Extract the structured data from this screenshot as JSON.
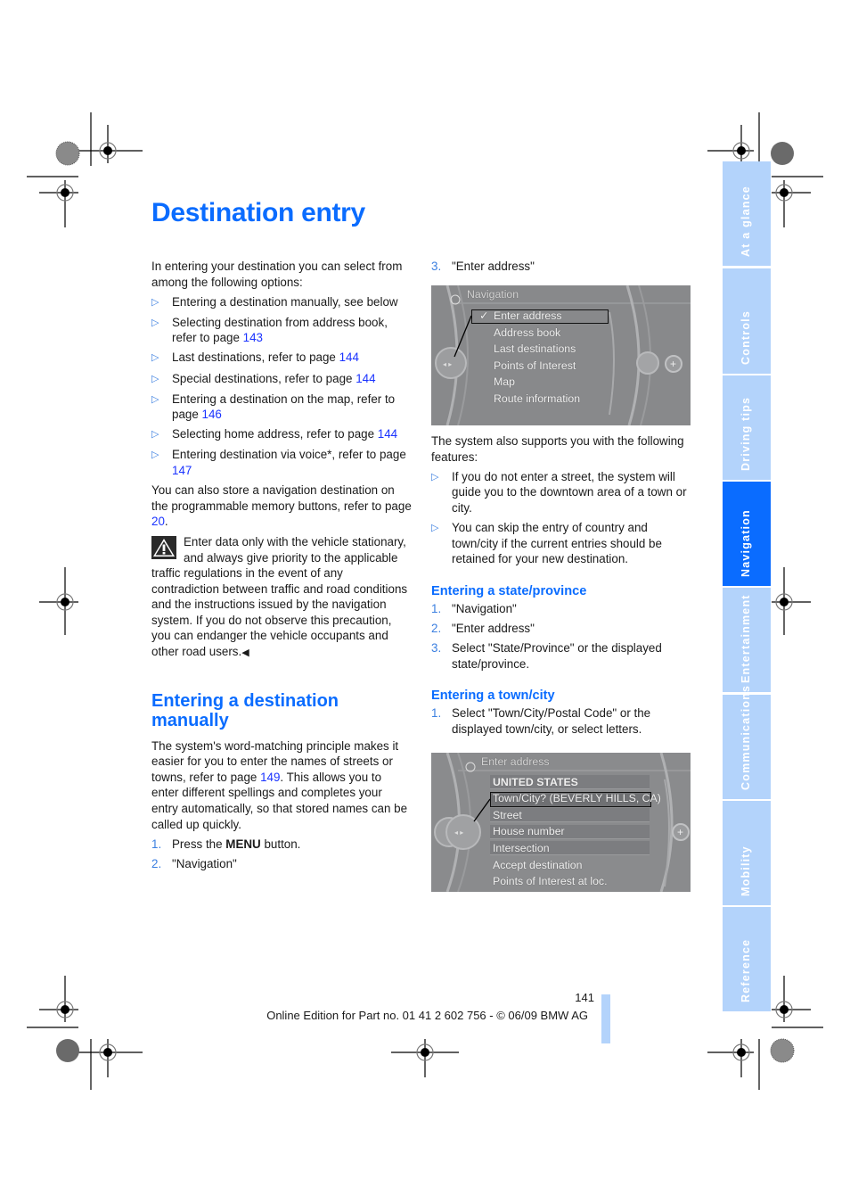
{
  "page": {
    "title": "Destination entry",
    "page_number": "141",
    "footer": "Online Edition for Part no. 01 41 2 602 756 - © 06/09 BMW AG"
  },
  "left": {
    "intro": "In entering your destination you can select from among the following options:",
    "options": [
      {
        "text": "Entering a destination manually, see below",
        "link": ""
      },
      {
        "text": "Selecting destination from address book, refer to page ",
        "link": "143"
      },
      {
        "text": "Last destinations, refer to page ",
        "link": "144"
      },
      {
        "text": "Special destinations, refer to page ",
        "link": "144"
      },
      {
        "text": "Entering a destination on the map, refer to page ",
        "link": "146"
      },
      {
        "text": "Selecting home address, refer to page ",
        "link": "144"
      },
      {
        "text": "Entering destination via voice*, refer to page ",
        "link": "147"
      }
    ],
    "memory_text": "You can also store a navigation destination on the programmable memory buttons, refer to page ",
    "memory_link": "20",
    "memory_end": ".",
    "warning": "Enter data only with the vehicle stationary, and always give priority to the applicable traffic regulations in the event of any contradiction between traffic and road conditions and the instructions issued by the navigation system. If you do not observe this precaution, you can endanger the vehicle occupants and other road users.",
    "warning_end_mark": "◀",
    "section_heading": "Entering a destination manually",
    "section_text_1": "The system's word-matching principle makes it easier for you to enter the names of streets or towns, refer to page ",
    "section_link": "149",
    "section_text_2": ". This allows you to enter different spellings and completes your entry automatically, so that stored names can be called up quickly.",
    "steps": [
      {
        "num": "1.",
        "pre": "Press the ",
        "bold": "MENU",
        "post": " button."
      },
      {
        "num": "2.",
        "pre": "\"Navigation\"",
        "bold": "",
        "post": ""
      }
    ]
  },
  "right": {
    "step3": {
      "num": "3.",
      "text": "\"Enter address\""
    },
    "screen1": {
      "header": "Navigation",
      "items": [
        "Enter address",
        "Address book",
        "Last destinations",
        "Points of Interest",
        "Map",
        "Route information"
      ],
      "selected_index": 0,
      "check_mark": "✓"
    },
    "features_intro": "The system also supports you with the following features:",
    "features": [
      "If you do not enter a street, the system will guide you to the downtown area of a town or city.",
      "You can skip the entry of country and town/city if the current entries should be retained for your new destination."
    ],
    "state_heading": "Entering a state/province",
    "state_steps": [
      {
        "num": "1.",
        "text": "\"Navigation\""
      },
      {
        "num": "2.",
        "text": "\"Enter address\""
      },
      {
        "num": "3.",
        "text": "Select \"State/Province\" or the displayed state/province."
      }
    ],
    "town_heading": "Entering a town/city",
    "town_steps": [
      {
        "num": "1.",
        "text": "Select \"Town/City/Postal Code\" or the displayed town/city, or select letters."
      }
    ],
    "screen2": {
      "header": "Enter address",
      "items": [
        "UNITED STATES",
        "Town/City? (BEVERLY HILLS, CA)",
        "Street",
        "House number",
        "Intersection",
        "Accept destination",
        "Points of Interest at loc."
      ],
      "selected_index": 1
    }
  },
  "tabs": [
    {
      "label": "At a glance",
      "active": false
    },
    {
      "label": "Controls",
      "active": false
    },
    {
      "label": "Driving tips",
      "active": false
    },
    {
      "label": "Navigation",
      "active": true
    },
    {
      "label": "Entertainment",
      "active": false
    },
    {
      "label": "Communications",
      "active": false
    },
    {
      "label": "Mobility",
      "active": false
    },
    {
      "label": "Reference",
      "active": false
    }
  ],
  "colors": {
    "accent": "#0a6cff",
    "tab_inactive": "#b3d3fb",
    "link": "#1a33ff",
    "bullet": "#3b7fe0"
  }
}
